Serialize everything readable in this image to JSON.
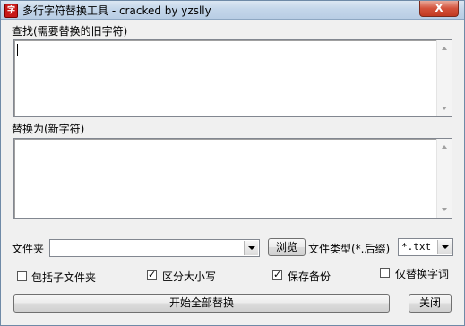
{
  "window": {
    "title": "多行字符替换工具 - cracked by yzslly",
    "close_glyph": "X"
  },
  "find": {
    "label": "查找(需要替换的旧字符)",
    "value": ""
  },
  "replace": {
    "label": "替换为(新字符)",
    "value": ""
  },
  "folder": {
    "label": "文件夹",
    "value": "",
    "browse_label": "浏览"
  },
  "filetype": {
    "label": "文件类型(*.后缀)",
    "value": "*.txt"
  },
  "options": {
    "include_subfolders": {
      "label": "包括子文件夹",
      "checked": false
    },
    "case_sensitive": {
      "label": "区分大小写",
      "checked": true
    },
    "keep_backup": {
      "label": "保存备份",
      "checked": true
    },
    "whole_word": {
      "label": "仅替换字词",
      "checked": false
    }
  },
  "actions": {
    "replace_all_label": "开始全部替换",
    "close_label": "关闭"
  }
}
